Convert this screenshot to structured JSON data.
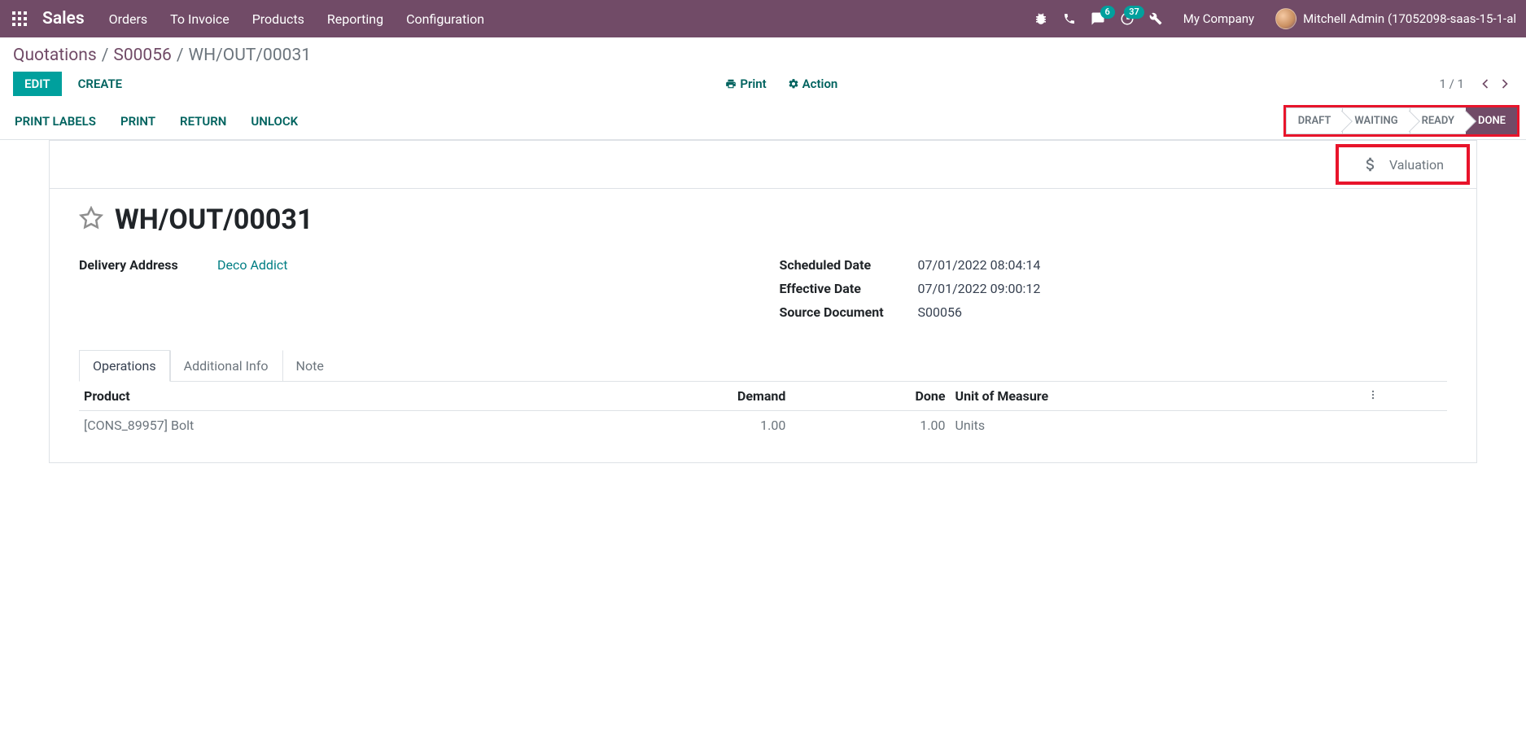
{
  "navbar": {
    "brand": "Sales",
    "menu": [
      "Orders",
      "To Invoice",
      "Products",
      "Reporting",
      "Configuration"
    ],
    "messages_badge": "6",
    "activities_badge": "37",
    "company": "My Company",
    "user": "Mitchell Admin (17052098-saas-15-1-al"
  },
  "breadcrumb": {
    "root": "Quotations",
    "parent": "S00056",
    "current": "WH/OUT/00031"
  },
  "buttons": {
    "edit": "EDIT",
    "create": "CREATE",
    "print": "Print",
    "action": "Action",
    "pager": "1 / 1"
  },
  "action_buttons": [
    "PRINT LABELS",
    "PRINT",
    "RETURN",
    "UNLOCK"
  ],
  "statuses": [
    "DRAFT",
    "WAITING",
    "READY",
    "DONE"
  ],
  "stat_button": {
    "label": "Valuation"
  },
  "record": {
    "name": "WH/OUT/00031",
    "delivery_address_label": "Delivery Address",
    "delivery_address": "Deco Addict",
    "scheduled_date_label": "Scheduled Date",
    "scheduled_date": "07/01/2022 08:04:14",
    "effective_date_label": "Effective Date",
    "effective_date": "07/01/2022 09:00:12",
    "source_doc_label": "Source Document",
    "source_doc": "S00056"
  },
  "tabs": [
    "Operations",
    "Additional Info",
    "Note"
  ],
  "table": {
    "headers": {
      "product": "Product",
      "demand": "Demand",
      "done": "Done",
      "uom": "Unit of Measure"
    },
    "rows": [
      {
        "product": "[CONS_89957] Bolt",
        "demand": "1.00",
        "done": "1.00",
        "uom": "Units"
      }
    ]
  }
}
